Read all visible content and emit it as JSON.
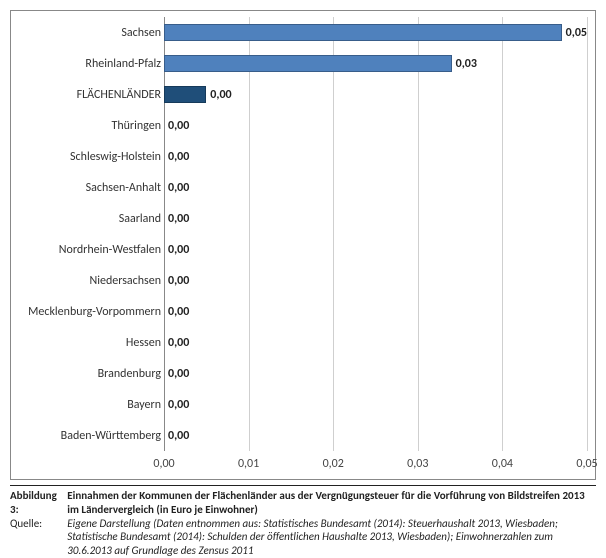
{
  "chart_data": {
    "type": "bar",
    "orientation": "horizontal",
    "categories": [
      "Sachsen",
      "Rheinland-Pfalz",
      "FLÄCHENLÄNDER",
      "Thüringen",
      "Schleswig-Holstein",
      "Sachsen-Anhalt",
      "Saarland",
      "Nordrhein-Westfalen",
      "Niedersachsen",
      "Mecklenburg-Vorpommern",
      "Hessen",
      "Brandenburg",
      "Bayern",
      "Baden-Württemberg"
    ],
    "values": [
      0.048,
      0.034,
      0.005,
      0.0,
      0.0,
      0.0,
      0.0,
      0.0,
      0.0,
      0.0,
      0.0,
      0.0,
      0.0,
      0.0
    ],
    "value_labels": [
      "0,05",
      "0,03",
      "0,00",
      "0,00",
      "0,00",
      "0,00",
      "0,00",
      "0,00",
      "0,00",
      "0,00",
      "0,00",
      "0,00",
      "0,00",
      "0,00"
    ],
    "highlight_index": 2,
    "xlim": [
      0.0,
      0.05
    ],
    "xticks": [
      0.0,
      0.01,
      0.02,
      0.03,
      0.04,
      0.05
    ],
    "xtick_labels": [
      "0,00",
      "0,01",
      "0,02",
      "0,03",
      "0,04",
      "0,05"
    ]
  },
  "caption": {
    "fig_label": "Abbildung 3:",
    "title": "Einnahmen der Kommunen der Flächenländer aus der Vergnügungsteuer für die Vorführung von Bildstreifen 2013 im Ländervergleich (in Euro je Einwohner)",
    "source_label": "Quelle:",
    "source_text": "Eigene Darstellung (Daten entnommen aus: Statistisches Bundesamt (2014): Steuerhaushalt 2013, Wiesbaden; Statistische Bundesamt (2014): Schulden der öffentlichen Haushalte 2013, Wiesbaden); Einwohnerzahlen zum 30.6.2013 auf Grundlage des Zensus 2011"
  }
}
